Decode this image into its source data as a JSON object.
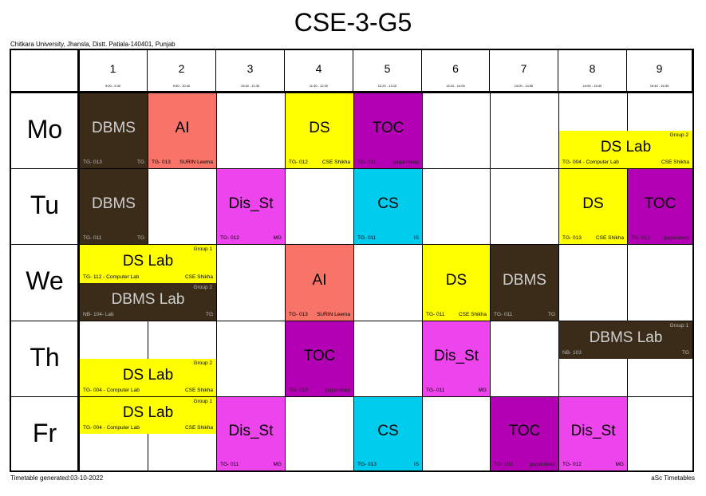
{
  "title": "CSE-3-G5",
  "university": "Chitkara University, Jhansla, Distt. Patiala-140401, Punjab",
  "footer": {
    "generated": "Timetable generated:03-10-2022",
    "brand": "aSc Timetables"
  },
  "periods": [
    {
      "num": "1",
      "time": "9:00 - 9:40"
    },
    {
      "num": "2",
      "time": "9:50 - 10:40"
    },
    {
      "num": "3",
      "time": "10:40 - 11:30"
    },
    {
      "num": "4",
      "time": "11:30 - 12:20"
    },
    {
      "num": "5",
      "time": "12:20 - 13:10"
    },
    {
      "num": "6",
      "time": "13:10 - 14:00"
    },
    {
      "num": "7",
      "time": "14:00 - 14:50"
    },
    {
      "num": "8",
      "time": "14:50 - 15:40"
    },
    {
      "num": "9",
      "time": "15:40 - 16:30"
    }
  ],
  "days": [
    "Mo",
    "Tu",
    "We",
    "Th",
    "Fr"
  ],
  "colors": {
    "yellow": "#ffff00",
    "brown": "#3b2c1a",
    "salmon": "#f87468",
    "purple": "#b400b4",
    "magenta": "#ee44ee",
    "cyan": "#00ccee"
  },
  "lessons": [
    {
      "day": 0,
      "start": 1,
      "span": 1,
      "part": "full",
      "subject": "DBMS",
      "room": "TG- 013",
      "teacher": "TG",
      "group": "",
      "color": "brown"
    },
    {
      "day": 0,
      "start": 2,
      "span": 1,
      "part": "full",
      "subject": "AI",
      "room": "TG- 013",
      "teacher": "SURIN Leema",
      "group": "",
      "color": "salmon"
    },
    {
      "day": 0,
      "start": 4,
      "span": 1,
      "part": "full",
      "subject": "DS",
      "room": "TG- 012",
      "teacher": "CSE Shikha",
      "group": "",
      "color": "yellow"
    },
    {
      "day": 0,
      "start": 5,
      "span": 1,
      "part": "full",
      "subject": "TOC",
      "room": "TG- 011",
      "teacher": "gagandeep",
      "group": "",
      "color": "purple"
    },
    {
      "day": 0,
      "start": 8,
      "span": 2,
      "part": "bottom",
      "subject": "DS Lab",
      "room": "TG- 004 - Computer Lab",
      "teacher": "CSE Shikha",
      "group": "Group 2",
      "color": "yellow"
    },
    {
      "day": 1,
      "start": 1,
      "span": 1,
      "part": "full",
      "subject": "DBMS",
      "room": "TG- 011",
      "teacher": "TG",
      "group": "",
      "color": "brown"
    },
    {
      "day": 1,
      "start": 3,
      "span": 1,
      "part": "full",
      "subject": "Dis_St",
      "room": "TG- 012",
      "teacher": "MG",
      "group": "",
      "color": "magenta"
    },
    {
      "day": 1,
      "start": 5,
      "span": 1,
      "part": "full",
      "subject": "CS",
      "room": "TG- 011",
      "teacher": "IS",
      "group": "",
      "color": "cyan"
    },
    {
      "day": 1,
      "start": 8,
      "span": 1,
      "part": "full",
      "subject": "DS",
      "room": "TG- 013",
      "teacher": "CSE Shikha",
      "group": "",
      "color": "yellow"
    },
    {
      "day": 1,
      "start": 9,
      "span": 1,
      "part": "full",
      "subject": "TOC",
      "room": "TG- 013",
      "teacher": "gagandeep",
      "group": "",
      "color": "purple"
    },
    {
      "day": 2,
      "start": 1,
      "span": 2,
      "part": "top",
      "subject": "DS Lab",
      "room": "TG- 112 - Computer Lab",
      "teacher": "CSE Shikha",
      "group": "Group 1",
      "color": "yellow"
    },
    {
      "day": 2,
      "start": 1,
      "span": 2,
      "part": "bottom",
      "subject": "DBMS Lab",
      "room": "NB- 104- Lab",
      "teacher": "TG",
      "group": "Group 2",
      "color": "brown"
    },
    {
      "day": 2,
      "start": 4,
      "span": 1,
      "part": "full",
      "subject": "AI",
      "room": "TG- 013",
      "teacher": "SURIN Leema",
      "group": "",
      "color": "salmon"
    },
    {
      "day": 2,
      "start": 6,
      "span": 1,
      "part": "full",
      "subject": "DS",
      "room": "TG- 011",
      "teacher": "CSE Shikha",
      "group": "",
      "color": "yellow"
    },
    {
      "day": 2,
      "start": 7,
      "span": 1,
      "part": "full",
      "subject": "DBMS",
      "room": "TG- 011",
      "teacher": "TG",
      "group": "",
      "color": "brown"
    },
    {
      "day": 3,
      "start": 1,
      "span": 2,
      "part": "bottom",
      "subject": "DS Lab",
      "room": "TG- 004 - Computer Lab",
      "teacher": "CSE Shikha",
      "group": "Group 2",
      "color": "yellow"
    },
    {
      "day": 3,
      "start": 4,
      "span": 1,
      "part": "full",
      "subject": "TOC",
      "room": "TG- 013",
      "teacher": "gagandeep",
      "group": "",
      "color": "purple"
    },
    {
      "day": 3,
      "start": 6,
      "span": 1,
      "part": "full",
      "subject": "Dis_St",
      "room": "TG- 011",
      "teacher": "MG",
      "group": "",
      "color": "magenta"
    },
    {
      "day": 3,
      "start": 8,
      "span": 2,
      "part": "top",
      "subject": "DBMS Lab",
      "room": "NB- 103",
      "teacher": "TG",
      "group": "Group 1",
      "color": "brown"
    },
    {
      "day": 4,
      "start": 1,
      "span": 2,
      "part": "top",
      "subject": "DS Lab",
      "room": "TG- 004 - Computer Lab",
      "teacher": "CSE Shikha",
      "group": "Group 1",
      "color": "yellow"
    },
    {
      "day": 4,
      "start": 3,
      "span": 1,
      "part": "full",
      "subject": "Dis_St",
      "room": "TG- 011",
      "teacher": "MG",
      "group": "",
      "color": "magenta"
    },
    {
      "day": 4,
      "start": 5,
      "span": 1,
      "part": "full",
      "subject": "CS",
      "room": "TG- 013",
      "teacher": "IS",
      "group": "",
      "color": "cyan"
    },
    {
      "day": 4,
      "start": 7,
      "span": 1,
      "part": "full",
      "subject": "TOC",
      "room": "TG- 103",
      "teacher": "gagandeep",
      "group": "",
      "color": "purple"
    },
    {
      "day": 4,
      "start": 8,
      "span": 1,
      "part": "full",
      "subject": "Dis_St",
      "room": "TG- 012",
      "teacher": "MG",
      "group": "",
      "color": "magenta"
    }
  ]
}
